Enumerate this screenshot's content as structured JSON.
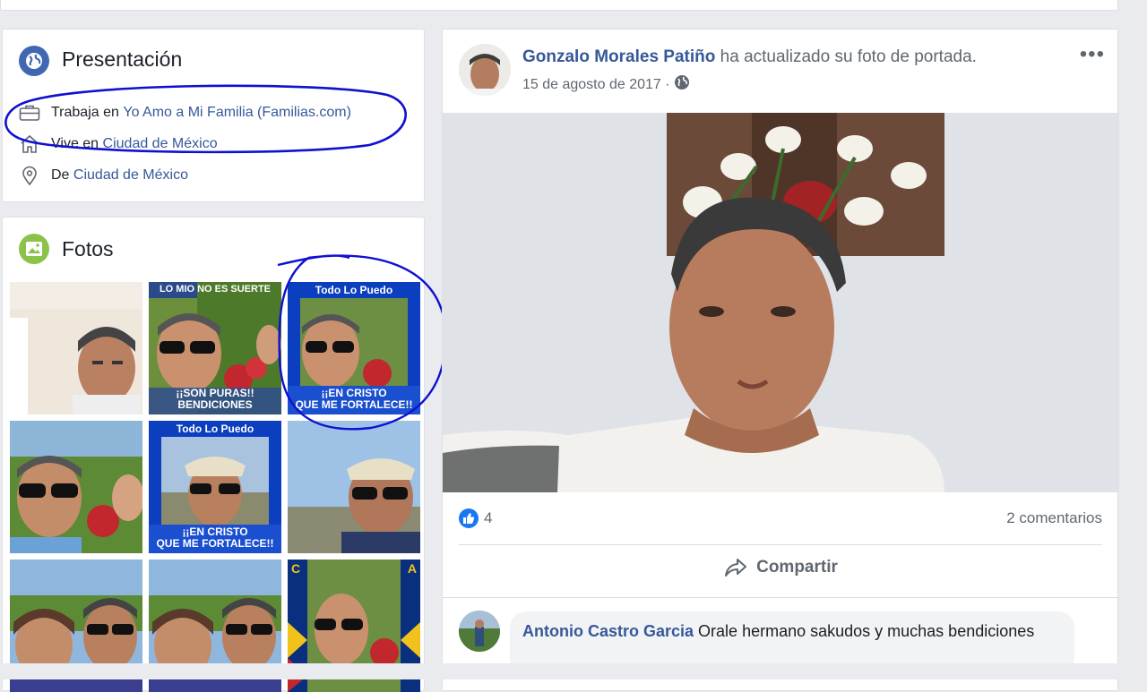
{
  "intro": {
    "title": "Presentación",
    "work_prefix": "Trabaja en",
    "work_link": "Yo Amo a Mi Familia (Familias.com)",
    "lives_prefix": "Vive en",
    "lives_link": "Ciudad de México",
    "from_prefix": "De",
    "from_link": "Ciudad de México"
  },
  "photos": {
    "title": "Fotos",
    "captions": {
      "t2_top": "LO MIO NO ES SUERTE",
      "t2_bottom": "¡¡SON PURAS!!",
      "t2_bottom2": "BENDICIONES",
      "t3_top": "Todo Lo Puedo",
      "t3_bottom": "¡¡EN CRISTO",
      "t3_bottom2": "QUE ME FORTALECE!!",
      "t5_top": "Todo Lo Puedo",
      "t5_bottom": "¡¡EN CRISTO",
      "t5_bottom2": "QUE ME FORTALECE!!",
      "t9_left": "C",
      "t9_right": "A"
    }
  },
  "post": {
    "author": "Gonzalo Morales Patiño",
    "action": "ha actualizado su foto de portada.",
    "date": "15 de agosto de 2017",
    "separator": "·",
    "more": "•••",
    "likes": "4",
    "comments": "2 comentarios",
    "share": "Compartir",
    "comment": {
      "author": "Antonio Castro Garcia",
      "text": "Orale hermano sakudos y muchas bendiciones"
    }
  },
  "colors": {
    "link": "#365899",
    "like_blue": "#1877f2",
    "annotation": "#1010d0"
  }
}
